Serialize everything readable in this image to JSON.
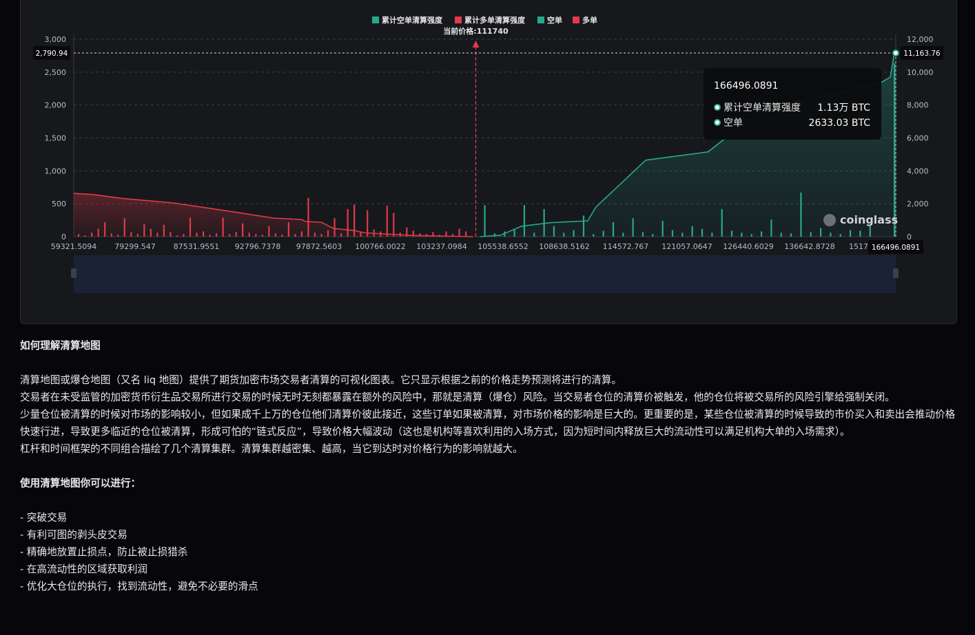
{
  "chart_data": {
    "type": "bar",
    "legend": [
      {
        "label": "累计空单清算强度",
        "color": "#26a98b"
      },
      {
        "label": "累计多单清算强度",
        "color": "#e23a48"
      },
      {
        "label": "空单",
        "color": "#26a98b"
      },
      {
        "label": "多单",
        "color": "#e23a48"
      }
    ],
    "legend_position": "top-center",
    "current_price_label": "当前价格:111740",
    "current_price": 111740,
    "x_range": [
      59321.5094,
      166496.0891
    ],
    "x_ticks": [
      "59321.5094",
      "79299.547",
      "87531.9551",
      "92796.7378",
      "97872.5603",
      "100766.0022",
      "103237.0984",
      "105538.6552",
      "108638.5162",
      "114572.767",
      "121057.0647",
      "126440.6029",
      "136642.8728",
      "1517"
    ],
    "x_hover_label": "166496.0891",
    "y_left_ticks": [
      "0",
      "500",
      "1,000",
      "1,500",
      "2,000",
      "2,500",
      "3,000"
    ],
    "y_left_range": [
      0,
      3000
    ],
    "y_right_ticks": [
      "0",
      "2,000",
      "4,000",
      "6,000",
      "8,000",
      "10,000",
      "12,000"
    ],
    "y_right_range": [
      0,
      12000
    ],
    "y_left_hover_label": "2,790.94",
    "y_right_hover_label": "11,163.76",
    "y_left_hover_value": 2790.94,
    "y_right_hover_value": 11163.76,
    "grid": true,
    "long_bars": [
      40,
      20,
      60,
      120,
      220,
      50,
      30,
      280,
      70,
      40,
      190,
      120,
      60,
      180,
      70,
      20,
      40,
      290,
      60,
      80,
      30,
      50,
      290,
      40,
      70,
      200,
      60,
      40,
      30,
      160,
      50,
      30,
      220,
      40,
      80,
      590,
      60,
      40,
      100,
      280,
      50,
      420,
      490,
      70,
      400,
      110,
      80,
      470,
      360,
      60,
      140,
      90,
      50,
      40,
      70,
      30,
      80,
      40,
      120,
      80
    ],
    "short_bars": [
      480,
      50,
      80,
      120,
      480,
      60,
      420,
      160,
      60,
      100,
      320,
      40,
      90,
      220,
      60,
      280,
      70,
      40,
      240,
      100,
      60,
      160,
      120,
      60,
      420,
      90,
      60,
      40,
      80,
      260,
      60,
      50,
      670,
      70,
      130,
      60,
      40,
      100,
      90,
      160,
      2633
    ],
    "long_cum_points": [
      [
        0,
        2630
      ],
      [
        0.05,
        2560
      ],
      [
        0.12,
        2330
      ],
      [
        0.25,
        2050
      ],
      [
        0.38,
        1580
      ],
      [
        0.5,
        1130
      ],
      [
        0.57,
        1040
      ],
      [
        0.58,
        920
      ],
      [
        0.62,
        880
      ],
      [
        0.65,
        500
      ],
      [
        0.7,
        380
      ],
      [
        0.73,
        230
      ],
      [
        0.85,
        70
      ],
      [
        1,
        0
      ]
    ],
    "short_cum_points": [
      [
        0,
        0
      ],
      [
        0.05,
        90
      ],
      [
        0.1,
        630
      ],
      [
        0.17,
        850
      ],
      [
        0.26,
        960
      ],
      [
        0.28,
        1800
      ],
      [
        0.4,
        4650
      ],
      [
        0.55,
        5150
      ],
      [
        0.69,
        7900
      ],
      [
        0.85,
        8640
      ],
      [
        0.97,
        9400
      ],
      [
        0.99,
        9700
      ],
      [
        1,
        11163.76
      ]
    ],
    "tooltip": {
      "title": "166496.0891",
      "rows": [
        {
          "label": "累计空单清算强度",
          "value": "1.13万 BTC"
        },
        {
          "label": "空单",
          "value": "2633.03 BTC"
        }
      ]
    },
    "watermark": "coinglass",
    "colors": {
      "long": "#e23a48",
      "short": "#26a98b"
    }
  },
  "article": {
    "heading1": "如何理解清算地图",
    "p1": "清算地图或爆仓地图（又名 liq 地图）提供了期货加密市场交易者清算的可视化图表。它只显示根据之前的价格走势预测将进行的清算。",
    "p2": "交易者在未受监管的加密货币衍生品交易所进行交易的时候无时无刻都暴露在额外的风险中，那就是清算（爆仓）风险。当交易者仓位的清算价被触发，他的仓位将被交易所的风险引擎给强制关闭。",
    "p3": "少量仓位被清算的时候对市场的影响较小，但如果成千上万的仓位他们清算价彼此接近，这些订单如果被清算，对市场价格的影响是巨大的。更重要的是，某些仓位被清算的时候导致的市价买入和卖出会推动价格快速行进，导致更多临近的仓位被清算，形成可怕的“链式反应”，导致价格大幅波动（这也是机构等喜欢利用的入场方式，因为短时间内释放巨大的流动性可以满足机构大单的入场需求）。",
    "p4": "杠杆和时间框架的不同组合描绘了几个清算集群。清算集群越密集、越高，当它到达时对价格行为的影响就越大。",
    "heading2": "使用清算地图你可以进行：",
    "items": [
      "- 突破交易",
      "- 有利可图的剥头皮交易",
      "- 精确地放置止损点，防止被止损猎杀",
      "- 在高流动性的区域获取利润",
      "- 优化大仓位的执行，找到流动性，避免不必要的滑点"
    ]
  }
}
